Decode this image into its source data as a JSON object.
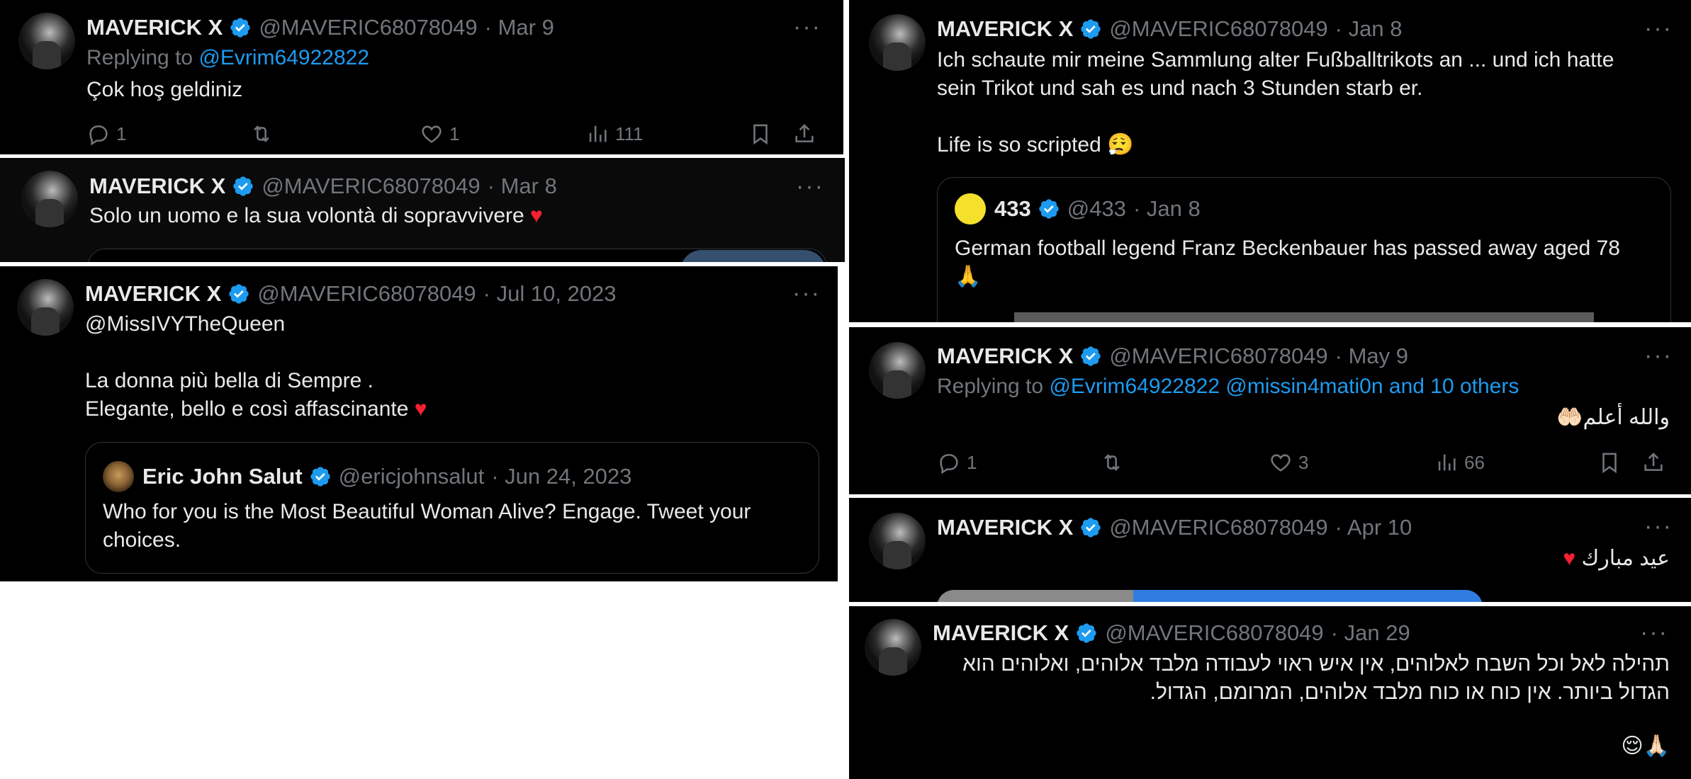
{
  "profile": {
    "name": "MAVERICK X",
    "handle": "@MAVERIC68078049"
  },
  "left": {
    "t1": {
      "date": "· Mar 9",
      "reply_prefix": "Replying to ",
      "reply_to": "@Evrim64922822",
      "text": "Çok hoş geldiniz",
      "stats": {
        "replies": "1",
        "reposts": "",
        "likes": "1",
        "views": "111"
      }
    },
    "t2": {
      "date": "· Mar 8",
      "text": "Solo un uomo e la sua volontà di sopravvivere"
    },
    "t3": {
      "date": "· Jul 10, 2023",
      "mention": "@MissIVYTheQueen",
      "line2": "La donna più bella di Sempre .",
      "line3": "Elegante, bello e così affascinante",
      "quote": {
        "name": "Eric John Salut",
        "handle": "@ericjohnsalut",
        "date": "· Jun 24, 2023",
        "text": "Who for you is the Most Beautiful Woman Alive? Engage. Tweet your choices."
      }
    }
  },
  "right": {
    "t4": {
      "date": "· Jan 8",
      "text": "Ich schaute mir meine Sammlung alter Fußballtrikots an ... und ich hatte sein Trikot und sah es und nach 3 Stunden starb er.",
      "text2": "Life is so scripted",
      "emoji": "😮‍💨",
      "quote": {
        "name": "433",
        "handle": "@433",
        "date": "· Jan 8",
        "text": "German football legend Franz Beckenbauer has passed away aged 78",
        "emoji": "🙏"
      }
    },
    "t5": {
      "date": "· May 9",
      "reply_prefix": "Replying to ",
      "reply_to": "@Evrim64922822 @missin4mati0n and 10 others",
      "text": "والله أعلم",
      "emoji": "🤲🏻",
      "stats": {
        "replies": "1",
        "reposts": "",
        "likes": "3",
        "views": "66"
      }
    },
    "t6": {
      "date": "· Apr 10",
      "text": "عيد مبارك"
    },
    "t7": {
      "date": "· Jan 29",
      "text": "תהילה לאל וכל השבח לאלוהים, אין איש ראוי לעבודה מלבד אלוהים, ואלוהים הוא הגדול ביותר. אין כוח או כוח מלבד אלוהים, המרומם, הגדול.",
      "emoji": "🙏🏻😌"
    }
  },
  "more_label": "···",
  "colors": {
    "bg": "#000000",
    "text": "#e7e9ea",
    "muted": "#71767b",
    "link": "#1d9bf0",
    "verified": "#1d9bf0",
    "heart": "#f4212e",
    "quote_border": "#2f3336"
  },
  "icons": [
    "reply-icon",
    "repost-icon",
    "like-icon",
    "views-icon",
    "bookmark-icon",
    "share-icon",
    "verified-badge-icon",
    "more-icon"
  ]
}
